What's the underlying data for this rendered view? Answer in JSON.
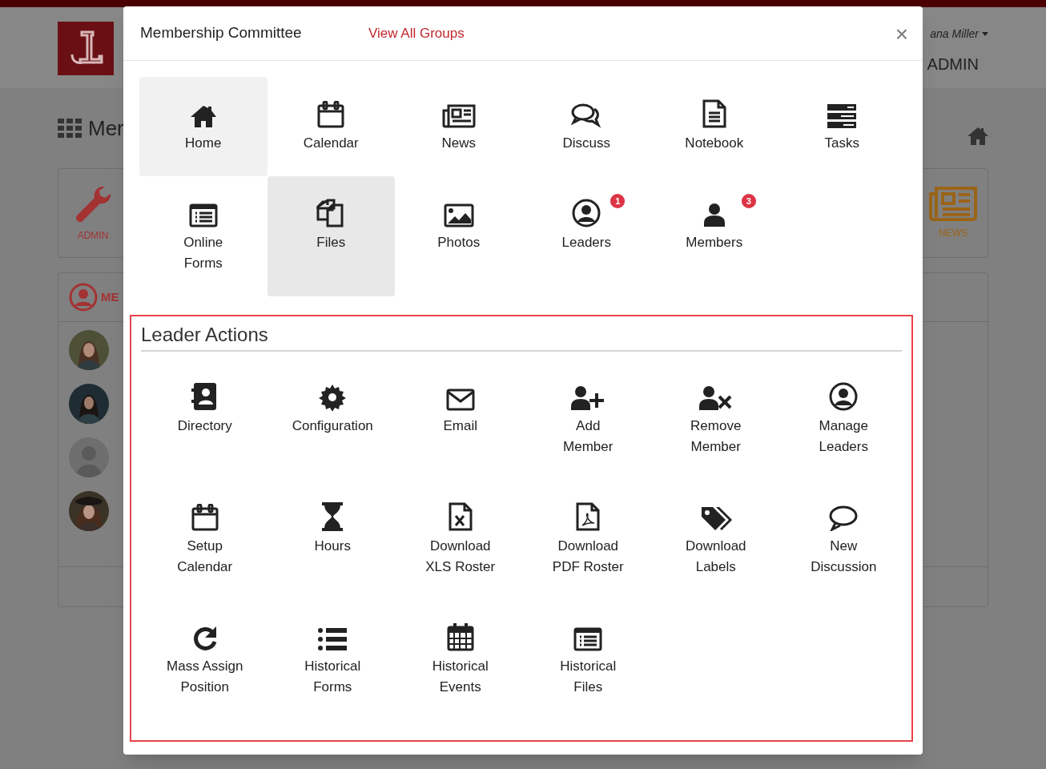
{
  "background": {
    "user_menu": "ana Miller",
    "nav_item": "ADMIN",
    "page_title": "Mer",
    "tiles": [
      {
        "label": "ADMIN"
      },
      {
        "label": "NEWS"
      }
    ],
    "panel_title": "ME"
  },
  "modal": {
    "title": "Membership Committee",
    "link": "View All Groups",
    "close": "×",
    "apps": [
      {
        "label": "Home",
        "selected": true,
        "hovered": false
      },
      {
        "label": "Calendar",
        "selected": false,
        "hovered": false
      },
      {
        "label": "News",
        "selected": false,
        "hovered": false
      },
      {
        "label": "Discuss",
        "selected": false,
        "hovered": false
      },
      {
        "label": "Notebook",
        "selected": false,
        "hovered": false
      },
      {
        "label": "Tasks",
        "selected": false,
        "hovered": false
      },
      {
        "label": "Online\nForms",
        "selected": false,
        "hovered": false
      },
      {
        "label": "Files",
        "selected": false,
        "hovered": true
      },
      {
        "label": "Photos",
        "selected": false,
        "hovered": false
      },
      {
        "label": "Leaders",
        "selected": false,
        "hovered": false,
        "badge": "1"
      },
      {
        "label": "Members",
        "selected": false,
        "hovered": false,
        "badge": "3"
      }
    ],
    "leader_actions": {
      "heading": "Leader Actions",
      "items": [
        {
          "label": "Directory"
        },
        {
          "label": "Configuration"
        },
        {
          "label": "Email"
        },
        {
          "label": "Add\nMember"
        },
        {
          "label": "Remove\nMember"
        },
        {
          "label": "Manage\nLeaders"
        },
        {
          "label": "Setup\nCalendar"
        },
        {
          "label": "Hours"
        },
        {
          "label": "Download\nXLS Roster"
        },
        {
          "label": "Download\nPDF Roster"
        },
        {
          "label": "Download\nLabels"
        },
        {
          "label": "New\nDiscussion"
        },
        {
          "label": "Mass Assign\nPosition"
        },
        {
          "label": "Historical\nForms"
        },
        {
          "label": "Historical\nEvents"
        },
        {
          "label": "Historical\nFiles"
        }
      ]
    }
  }
}
